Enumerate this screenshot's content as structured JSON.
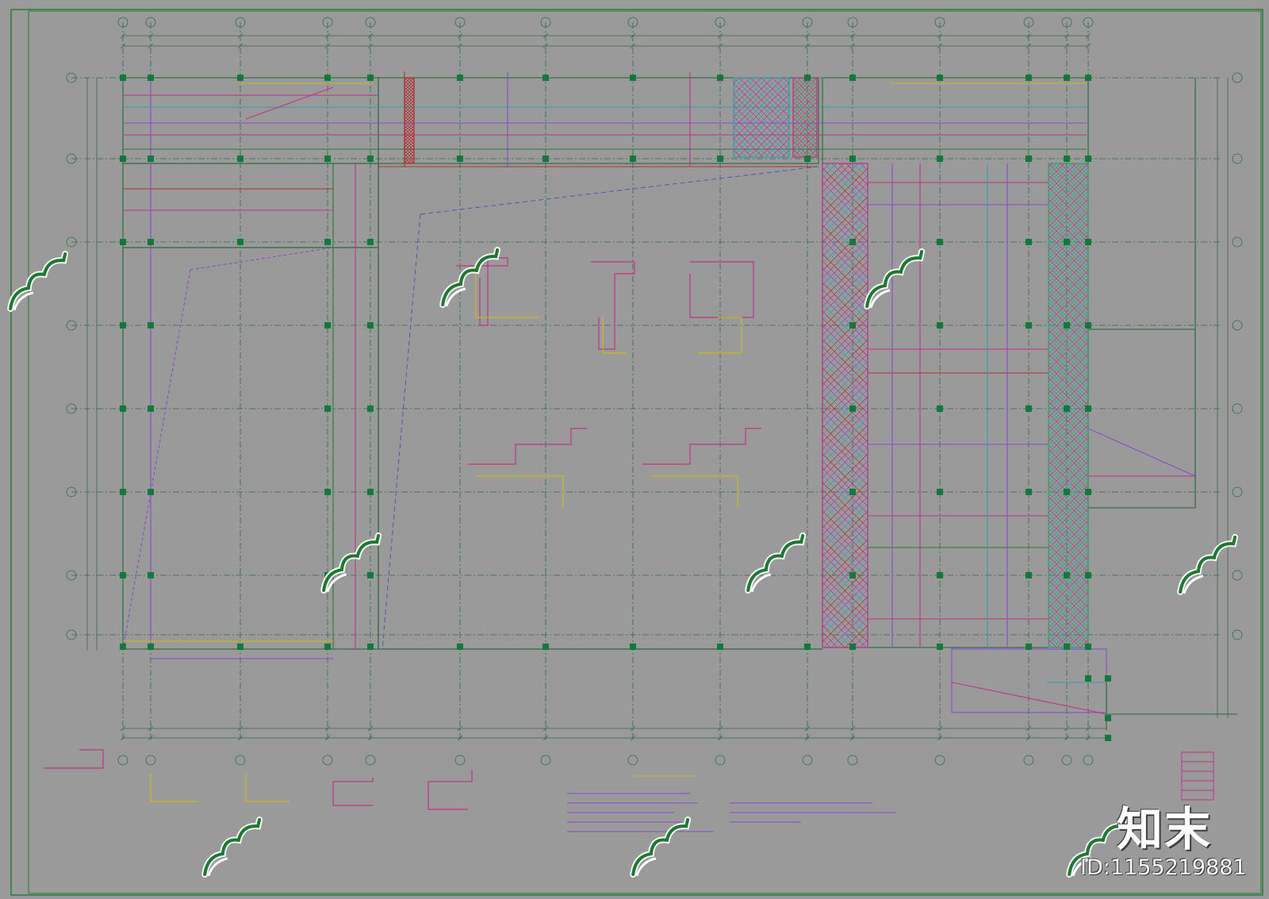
{
  "watermark": {
    "brand": "知末",
    "id_label": "ID:1155219881"
  },
  "colors": {
    "background": "#9a9a9a",
    "border": "#1f7a3a",
    "grid": "#2f6a4a",
    "column": "#0f7a3a",
    "accent_magenta": "#c4308a",
    "accent_violet": "#8a4ad0",
    "accent_red": "#b0302a",
    "accent_yellow": "#c8b820",
    "accent_cyan": "#30a0b0"
  }
}
